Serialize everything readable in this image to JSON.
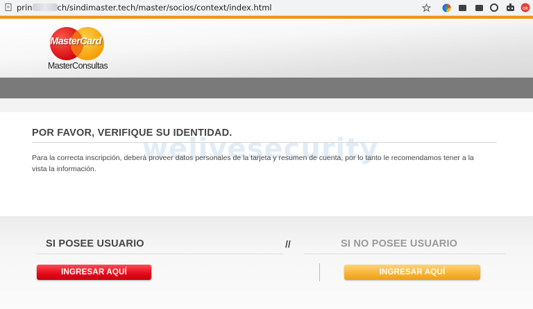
{
  "browser": {
    "url_prefix": "prin",
    "url_suffix": "ch/sindimaster.tech/master/socios/context/index.html",
    "icons": [
      "page-info-icon",
      "bookmark-star-icon",
      "extension-1-icon",
      "extension-2-icon",
      "extension-3-icon",
      "extension-4-icon",
      "extension-5-icon",
      "extension-6-icon"
    ]
  },
  "header": {
    "logo_word": "MasterCard",
    "logo_subtitle": "MasterConsultas",
    "colors": {
      "accent_orange": "#f29312",
      "logo_red": "#e30613",
      "logo_yellow": "#f9a11b",
      "band_grey": "#7a7a7a"
    }
  },
  "identity": {
    "title": "POR FAVOR, VERIFIQUE SU IDENTIDAD.",
    "text": "Para la correcta inscripción, deberá proveer datos personales de la tarjeta y resumen de cuenta, por lo tanto le recomendamos tener a la vista la información.",
    "watermark": "welivesecurity"
  },
  "columns": {
    "left_title": "SI POSEE USUARIO",
    "separator": "//",
    "right_title": "SI NO POSEE USUARIO",
    "left_button": "INGRESAR AQUÍ",
    "right_button": "INGRESAR AQUÍ",
    "colors": {
      "red_button": "#e3091a",
      "yellow_button": "#f7b232"
    }
  }
}
